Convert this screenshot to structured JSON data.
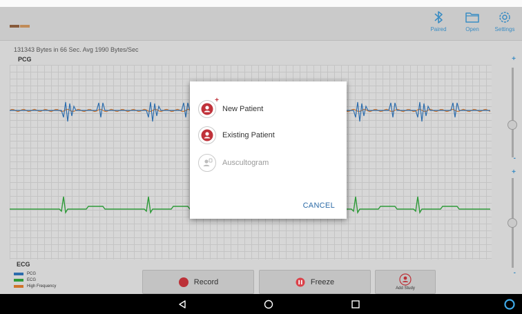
{
  "appbar": {
    "actions": [
      {
        "label": "Paired",
        "icon": "bluetooth-icon"
      },
      {
        "label": "Open",
        "icon": "folder-icon"
      },
      {
        "label": "Settings",
        "icon": "gear-icon"
      }
    ]
  },
  "status": {
    "stats": "131343 Bytes in 66 Sec. Avg 1990 Bytes/Sec"
  },
  "chart": {
    "pcg_label": "PCG",
    "ecg_label": "ECG"
  },
  "legend": [
    {
      "label": "PCG",
      "color": "#2d6fb0"
    },
    {
      "label": "ECG",
      "color": "#2e9e3a"
    },
    {
      "label": "High Frequency",
      "color": "#d4762a"
    }
  ],
  "bottom": {
    "record": "Record",
    "freeze": "Freeze",
    "add_study": "Add Study"
  },
  "dialog": {
    "options": [
      {
        "label": "New Patient",
        "icon": "new-patient-icon",
        "enabled": true
      },
      {
        "label": "Existing Patient",
        "icon": "existing-patient-icon",
        "enabled": true
      },
      {
        "label": "Auscultogram",
        "icon": "auscultogram-icon",
        "enabled": false
      }
    ],
    "cancel": "CANCEL"
  },
  "colors": {
    "accent": "#3b8fc7",
    "record_red": "#c0323a",
    "freeze_red": "#e0424a",
    "pcg": "#2d6fb0",
    "ecg": "#2e9e3a",
    "high_freq": "#d4762a"
  },
  "navbar": {
    "icons": [
      "back-icon",
      "home-icon",
      "recents-icon",
      "assistant-icon"
    ]
  }
}
